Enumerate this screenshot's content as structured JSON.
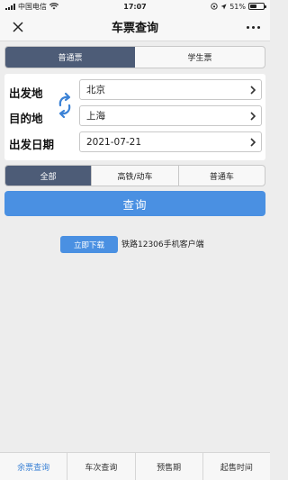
{
  "status_bar": {
    "carrier": "中国电信",
    "time": "17:07",
    "battery_text": "51%",
    "battery_level": 0.51
  },
  "nav": {
    "title": "车票查询"
  },
  "ticket_tabs": [
    {
      "label": "普通票",
      "active": true
    },
    {
      "label": "学生票",
      "active": false
    }
  ],
  "form": {
    "from_label": "出发地",
    "to_label": "目的地",
    "date_label": "出发日期",
    "from_value": "北京",
    "to_value": "上海",
    "date_value": "2021-07-21"
  },
  "train_tabs": [
    {
      "label": "全部",
      "active": true
    },
    {
      "label": "高铁/动车",
      "active": false
    },
    {
      "label": "普通车",
      "active": false
    }
  ],
  "query_button": "查询",
  "download": {
    "button_label": "立即下载",
    "text": "铁路12306手机客户端"
  },
  "bottom_tabs": [
    {
      "label": "余票查询",
      "active": true
    },
    {
      "label": "车次查询",
      "active": false
    },
    {
      "label": "预售期",
      "active": false
    },
    {
      "label": "起售时间",
      "active": false
    }
  ],
  "colors": {
    "accent": "#4a90e2",
    "tab_active": "#4d5c77",
    "bottom_active": "#3b82d6"
  }
}
